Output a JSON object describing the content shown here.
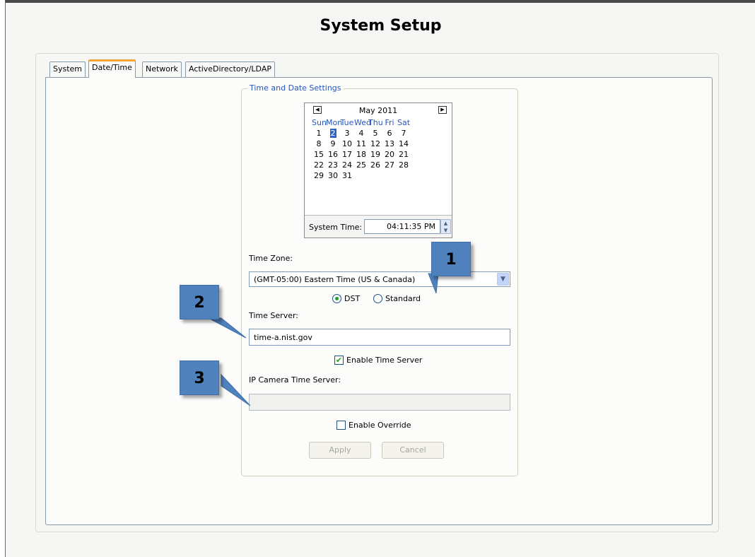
{
  "page": {
    "title": "System Setup"
  },
  "tabs": [
    {
      "label": "System",
      "active": false
    },
    {
      "label": "Date/Time",
      "active": true
    },
    {
      "label": "Network",
      "active": false
    },
    {
      "label": "ActiveDirectory/LDAP",
      "active": false
    }
  ],
  "settings": {
    "legend": "Time and Date Settings",
    "calendar": {
      "month_label": "May 2011",
      "prev_icon": "left-arrow-icon",
      "next_icon": "right-arrow-icon",
      "weekdays": [
        "Sun",
        "Mon",
        "Tue",
        "Wed",
        "Thu",
        "Fri",
        "Sat"
      ],
      "weeks": [
        [
          "1",
          "2",
          "3",
          "4",
          "5",
          "6",
          "7"
        ],
        [
          "8",
          "9",
          "10",
          "11",
          "12",
          "13",
          "14"
        ],
        [
          "15",
          "16",
          "17",
          "18",
          "19",
          "20",
          "21"
        ],
        [
          "22",
          "23",
          "24",
          "25",
          "26",
          "27",
          "28"
        ],
        [
          "29",
          "30",
          "31",
          "",
          "",
          "",
          ""
        ]
      ],
      "selected_day": "2"
    },
    "system_time_label": "System Time:",
    "system_time_value": "04:11:35 PM",
    "timezone_label": "Time Zone:",
    "timezone_value": "(GMT-05:00) Eastern Time (US & Canada)",
    "dst_label": "DST",
    "standard_label": "Standard",
    "dst_selected": true,
    "time_server_label": "Time Server:",
    "time_server_value": "time-a.nist.gov",
    "enable_time_server_label": "Enable Time Server",
    "enable_time_server_checked": true,
    "ip_camera_label": "IP Camera Time Server:",
    "ip_camera_value": "",
    "enable_override_label": "Enable Override",
    "enable_override_checked": false,
    "apply_label": "Apply",
    "cancel_label": "Cancel"
  },
  "callouts": [
    "1",
    "2",
    "3"
  ],
  "colors": {
    "accent": "#2456bb",
    "tab_active": "#f4a43a",
    "callout": "#4f81bd",
    "check": "#21a121"
  }
}
